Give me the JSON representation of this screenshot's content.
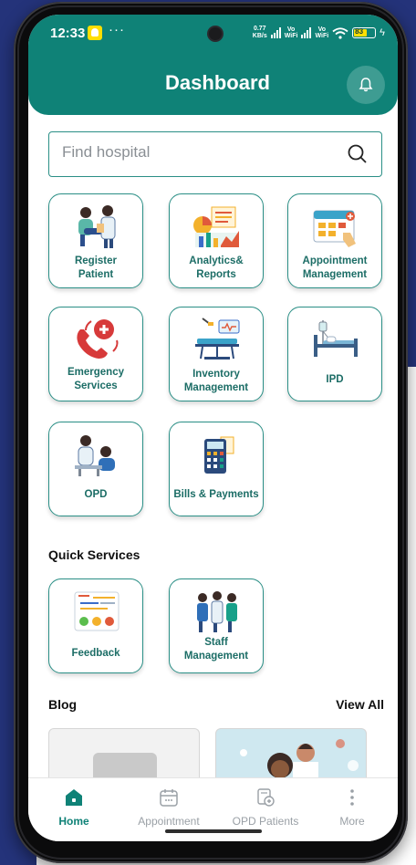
{
  "status_bar": {
    "time": "12:33",
    "dots": "···",
    "net_speed_value": "0.77",
    "net_speed_unit": "KB/s",
    "vo_label_1": "Vo",
    "wifi_label_1": "WiFi",
    "vo_label_2": "Vo",
    "wifi_label_2": "WiFi",
    "battery": "83"
  },
  "header": {
    "title": "Dashboard"
  },
  "search": {
    "placeholder": "Find hospital"
  },
  "services": [
    {
      "label_line1": "Register",
      "label_line2": "Patient",
      "icon": "register-patient-icon"
    },
    {
      "label_line1": "Analytics&",
      "label_line2": "Reports",
      "icon": "analytics-reports-icon"
    },
    {
      "label_line1": "Appointment",
      "label_line2": "Management",
      "icon": "appointment-calendar-icon"
    },
    {
      "label_line1": "Emergency",
      "label_line2": "Services",
      "icon": "emergency-phone-icon"
    },
    {
      "label_line1": "Inventory",
      "label_line2": "Management",
      "icon": "inventory-bed-icon"
    },
    {
      "label_line1": "IPD",
      "label_line2": "",
      "icon": "ipd-bed-icon"
    },
    {
      "label_line1": "OPD",
      "label_line2": "",
      "icon": "opd-consult-icon"
    },
    {
      "label_line1": "Bills & Payments",
      "label_line2": "",
      "icon": "bills-calculator-icon"
    }
  ],
  "quick_services": {
    "title": "Quick Services",
    "items": [
      {
        "label_line1": "Feedback",
        "label_line2": "",
        "icon": "feedback-icon"
      },
      {
        "label_line1": "Staff",
        "label_line2": "Management",
        "icon": "staff-team-icon"
      }
    ]
  },
  "blog": {
    "title": "Blog",
    "view_all": "View All"
  },
  "bottom_nav": [
    {
      "label": "Home",
      "icon": "home-icon",
      "active": true
    },
    {
      "label": "Appointment",
      "icon": "calendar-icon",
      "active": false
    },
    {
      "label": "OPD Patients",
      "icon": "opd-patients-icon",
      "active": false
    },
    {
      "label": "More",
      "icon": "more-vertical-icon",
      "active": false
    }
  ],
  "colors": {
    "primary": "#0f8277",
    "tile_border": "#2a8f86",
    "tile_text": "#1c6d66",
    "background_navy": "#24337a"
  }
}
